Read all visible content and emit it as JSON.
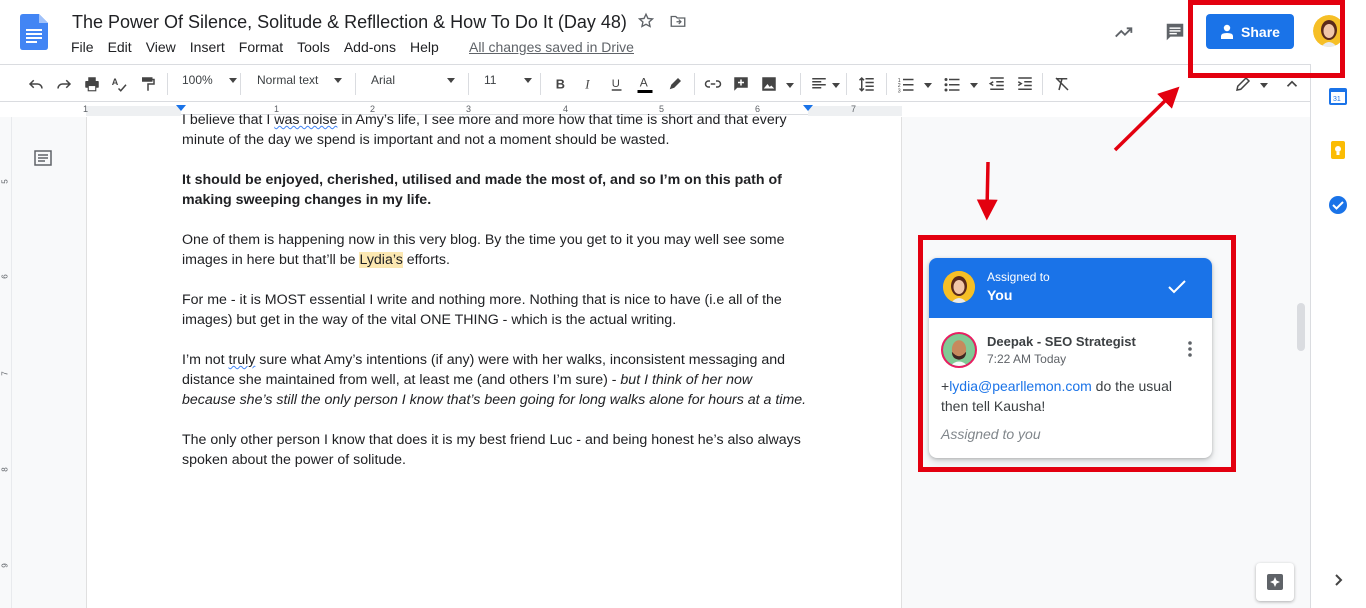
{
  "app": {
    "title": "The Power Of Silence, Solitude & Reflleсtion & How To Do It (Day 48)",
    "saved_status": "All changes saved in Drive",
    "share_label": "Share"
  },
  "menu": {
    "items": [
      "File",
      "Edit",
      "View",
      "Insert",
      "Format",
      "Tools",
      "Add-ons",
      "Help"
    ]
  },
  "toolbar": {
    "zoom": "100%",
    "style": "Normal text",
    "font": "Arial",
    "font_size": "11"
  },
  "ruler": {
    "marks": [
      "1",
      "1",
      "2",
      "3",
      "4",
      "5",
      "6",
      "7"
    ]
  },
  "vruler": {
    "marks": [
      "5",
      "6",
      "7",
      "8",
      "9"
    ]
  },
  "document": {
    "p1_a": "I believe that I ",
    "p1_squig": "was noise",
    "p1_b": " in Amy’s life, I see more and more how that time is short and that every minute of the day we spend is important and not a moment should be wasted.",
    "p2": "It should be enjoyed, cherished, utilised and made the most of, and so I’m on this path of making sweeping changes in my life.",
    "p3_a": "One of them is happening now in this very blog. By the time you get to it you may well see some images in here but that’ll be ",
    "p3_hl": "Lydia’s",
    "p3_b": " efforts.",
    "p4": "For me - it is MOST essential I write and nothing more. Nothing that is nice to have (i.e all of the images) but get in the way of the vital ONE THING - which is the actual writing.",
    "p5_a": "I’m not ",
    "p5_squig": "truly",
    "p5_b": " sure what Amy’s intentions (if any) were with her walks, inconsistent messaging and distance she maintained from well, at least me (and others I’m sure) - ",
    "p5_ital": "but I think of her now because she’s still the only person I know that’s been going for long walks alone for hours at a time.",
    "p6": "The only other person I know that does it is my best friend Luc - and being honest he’s also always spoken about the power of solitude."
  },
  "comment": {
    "assigned_label": "Assigned to",
    "assigned_name": "You",
    "author": "Deepak - SEO Strategist",
    "time": "7:22 AM Today",
    "body_prefix": "+",
    "mention": "lydia@pearllemon.com",
    "body_rest": " do the usual then tell Kausha!",
    "assigned_footer": "Assigned to you"
  },
  "colors": {
    "accent": "#1a73e8",
    "annotation_red": "#e3000f",
    "highlight": "#fce8b2"
  },
  "icons": [
    "docs-logo-icon",
    "star-icon",
    "move-folder-icon",
    "activity-trend-icon",
    "comments-icon",
    "person-icon",
    "undo-icon",
    "redo-icon",
    "print-icon",
    "spellcheck-icon",
    "paint-format-icon",
    "bold-icon",
    "italic-icon",
    "underline-icon",
    "text-color-icon",
    "highlight-icon",
    "link-icon",
    "add-comment-icon",
    "image-icon",
    "align-icon",
    "line-spacing-icon",
    "numbered-list-icon",
    "bulleted-list-icon",
    "decrease-indent-icon",
    "increase-indent-icon",
    "clear-formatting-icon",
    "editing-mode-icon",
    "collapse-icon",
    "outline-icon",
    "calendar-icon",
    "keep-icon",
    "tasks-icon",
    "check-icon",
    "more-vert-icon",
    "expand-panel-icon",
    "explore-icon"
  ]
}
